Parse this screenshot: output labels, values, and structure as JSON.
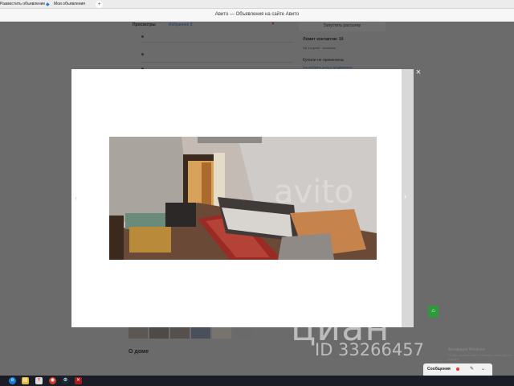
{
  "browser": {
    "tabs": [
      {
        "label": "Разместить объявление"
      },
      {
        "label": "Мои объявления"
      }
    ],
    "new_tab_label": "+",
    "window_title": "Авито — Объявления на сайте Авито"
  },
  "listing": {
    "views_label": "Просмотры",
    "views_count": "Избранное  8",
    "promote_button": "Запустить рассылку",
    "contacts_limit": "Лимит контактов: 10",
    "contacts_limit_sub": "На 14 дней · осталось",
    "buy_question": "Купили не применены",
    "buy_link": "Как выбрать услугу продвижения",
    "about_heading": "О доме"
  },
  "lightbox": {
    "close_glyph": "×",
    "prev_glyph": "‹",
    "next_glyph": "›",
    "photo_watermark": "avito"
  },
  "watermark": {
    "brand": "циан",
    "listing_id": "ID 33266457"
  },
  "windows": {
    "activate_title": "Активация Windows",
    "activate_sub": "Чтобы активировать Windows, перейдите в раздел"
  },
  "messenger": {
    "label": "Сообщения",
    "edit_icon": "✎",
    "chevron": "⌄"
  },
  "colors": {
    "overlay": "#6b6b6b",
    "lightbox_bg": "#ffffff",
    "cian_green": "#2f9a3c",
    "taskbar": "#1b1d26"
  }
}
